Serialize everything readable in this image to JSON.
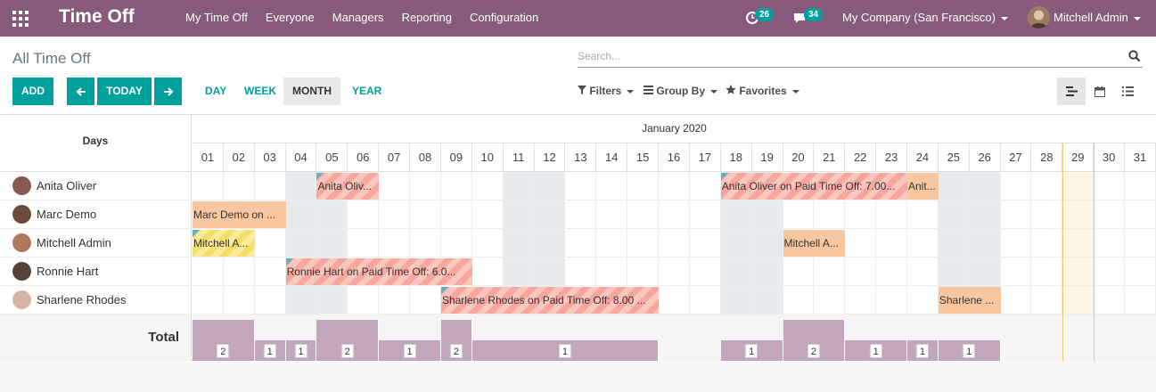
{
  "navbar": {
    "brand": "Time Off",
    "menu": [
      "My Time Off",
      "Everyone",
      "Managers",
      "Reporting",
      "Configuration"
    ],
    "activity_count": "26",
    "message_count": "34",
    "company": "My Company (San Francisco)",
    "user": "Mitchell Admin"
  },
  "control": {
    "breadcrumb": "All Time Off",
    "search_placeholder": "Search...",
    "add_label": "ADD",
    "today_label": "TODAY",
    "scales": [
      "DAY",
      "WEEK",
      "MONTH",
      "YEAR"
    ],
    "active_scale": "MONTH",
    "filters_label": "Filters",
    "groupby_label": "Group By",
    "favorites_label": "Favorites"
  },
  "gantt": {
    "days_label": "Days",
    "month_label": "January 2020",
    "days": [
      "01",
      "02",
      "03",
      "04",
      "05",
      "06",
      "07",
      "08",
      "09",
      "10",
      "11",
      "12",
      "13",
      "14",
      "15",
      "16",
      "17",
      "18",
      "19",
      "20",
      "21",
      "22",
      "23",
      "24",
      "25",
      "26",
      "27",
      "28",
      "29",
      "30",
      "31"
    ],
    "weekend_days": [
      4,
      5,
      11,
      12,
      18,
      19,
      25,
      26
    ],
    "today_day": 29,
    "total_label": "Total",
    "rows": [
      {
        "name": "Anita Oliver",
        "avatar_color": "#8a5a52",
        "pills": [
          {
            "start": 5,
            "end": 6,
            "label": "Anita Oliv...",
            "state": "refused",
            "marker": true
          },
          {
            "start": 18,
            "end": 23,
            "label": "Anita Oliver on Paid Time Off: 7.00...",
            "state": "refused",
            "marker": true
          },
          {
            "start": 24,
            "end": 24,
            "label": "Anit...",
            "state": "validated",
            "marker": false
          }
        ]
      },
      {
        "name": "Marc Demo",
        "avatar_color": "#6d4b3b",
        "pills": [
          {
            "start": 1,
            "end": 3,
            "label": "Marc Demo on ...",
            "state": "validated",
            "marker": false
          }
        ]
      },
      {
        "name": "Mitchell Admin",
        "avatar_color": "#b0785a",
        "pills": [
          {
            "start": 1,
            "end": 2,
            "label": "Mitchell A...",
            "state": "confirmed",
            "marker": true
          },
          {
            "start": 20,
            "end": 21,
            "label": "Mitchell A...",
            "state": "validated",
            "marker": false
          }
        ]
      },
      {
        "name": "Ronnie Hart",
        "avatar_color": "#5a4036",
        "pills": [
          {
            "start": 4,
            "end": 9,
            "label": "Ronnie Hart on Paid Time Off: 6.0...",
            "state": "refused",
            "marker": true
          }
        ]
      },
      {
        "name": "Sharlene Rhodes",
        "avatar_color": "#d7b3a8",
        "pills": [
          {
            "start": 9,
            "end": 15,
            "label": "Sharlene Rhodes on Paid Time Off: 8.00 ...",
            "state": "refused",
            "marker": true
          },
          {
            "start": 25,
            "end": 26,
            "label": "Sharlene ...",
            "state": "validated",
            "marker": false
          }
        ]
      }
    ],
    "totals": [
      {
        "start": 1,
        "end": 2,
        "value": 2
      },
      {
        "start": 3,
        "end": 3,
        "value": 1
      },
      {
        "start": 4,
        "end": 4,
        "value": 1
      },
      {
        "start": 5,
        "end": 6,
        "value": 2
      },
      {
        "start": 7,
        "end": 8,
        "value": 1
      },
      {
        "start": 9,
        "end": 9,
        "value": 2
      },
      {
        "start": 10,
        "end": 15,
        "value": 1
      },
      {
        "start": 18,
        "end": 19,
        "value": 1
      },
      {
        "start": 20,
        "end": 21,
        "value": 2
      },
      {
        "start": 22,
        "end": 23,
        "value": 1
      },
      {
        "start": 24,
        "end": 24,
        "value": 1
      },
      {
        "start": 25,
        "end": 26,
        "value": 1
      }
    ]
  }
}
